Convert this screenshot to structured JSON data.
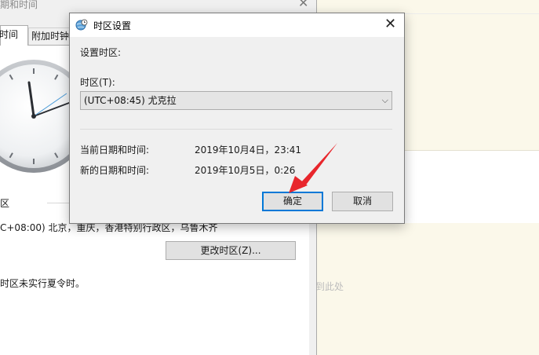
{
  "background_window": {
    "title": "期和时间",
    "close_glyph": "✕",
    "tabs": [
      {
        "label": "时间"
      },
      {
        "label": "附加时钟"
      }
    ],
    "timezone_section_label": "区",
    "current_timezone": "C+08:00) 北京，重庆，香港特别行政区，乌鲁木齐",
    "change_timezone_button": "更改时区(Z)...",
    "dst_note": "时区未实行夏令时。"
  },
  "right_panel": {
    "drop_hint": "到此处"
  },
  "dialog": {
    "title": "时区设置",
    "icon": "globe-clock-icon",
    "close_glyph": "✕",
    "settings_label": "设置时区:",
    "timezone_label": "时区(T):",
    "timezone_selected": "(UTC+08:45) 尤克拉",
    "dropdown_glyph": "⌵",
    "current_datetime_label": "当前日期和时间:",
    "current_datetime_value": "2019年10月4日，23:41",
    "new_datetime_label": "新的日期和时间:",
    "new_datetime_value": "2019年10月5日，0:26",
    "ok_button": "确定",
    "cancel_button": "取消"
  },
  "colors": {
    "accent": "#0078d7",
    "annotation_arrow": "#e8262c",
    "dialog_bg": "#f0f0f0",
    "right_panel_bg": "#fbf8ea"
  }
}
